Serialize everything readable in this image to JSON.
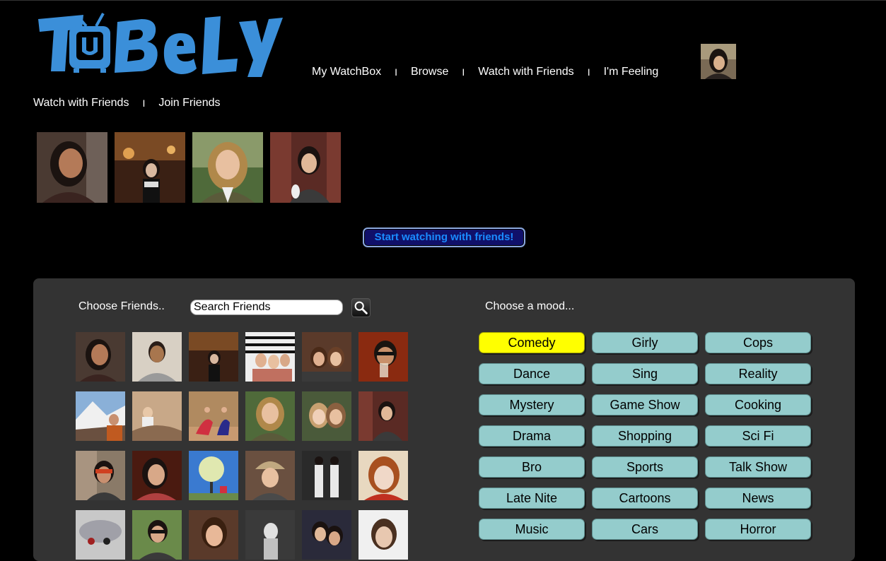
{
  "brand": {
    "logo_text": "TUBELY",
    "accent_color": "#3b8fd9"
  },
  "nav": {
    "items": [
      "My WatchBox",
      "Browse",
      "Watch with Friends",
      "I'm Feeling"
    ],
    "separator": "I"
  },
  "subnav": {
    "items": [
      "Watch with Friends",
      "Join Friends"
    ],
    "separator": "I"
  },
  "start_button": {
    "label": "Start watching with friends!"
  },
  "friends_panel": {
    "label": "Choose Friends..",
    "search_placeholder": "Search Friends",
    "search_icon": "magnifier-icon"
  },
  "mood_panel": {
    "label": "Choose a mood...",
    "selected": "Comedy",
    "selected_color": "#ffff00",
    "button_color": "#94cccc",
    "moods": [
      "Comedy",
      "Girly",
      "Cops",
      "Dance",
      "Sing",
      "Reality",
      "Mystery",
      "Game Show",
      "Cooking",
      "Drama",
      "Shopping",
      "Sci Fi",
      "Bro",
      "Sports",
      "Talk Show",
      "Late Nite",
      "Cartoons",
      "News",
      "Music",
      "Cars",
      "Horror"
    ]
  }
}
